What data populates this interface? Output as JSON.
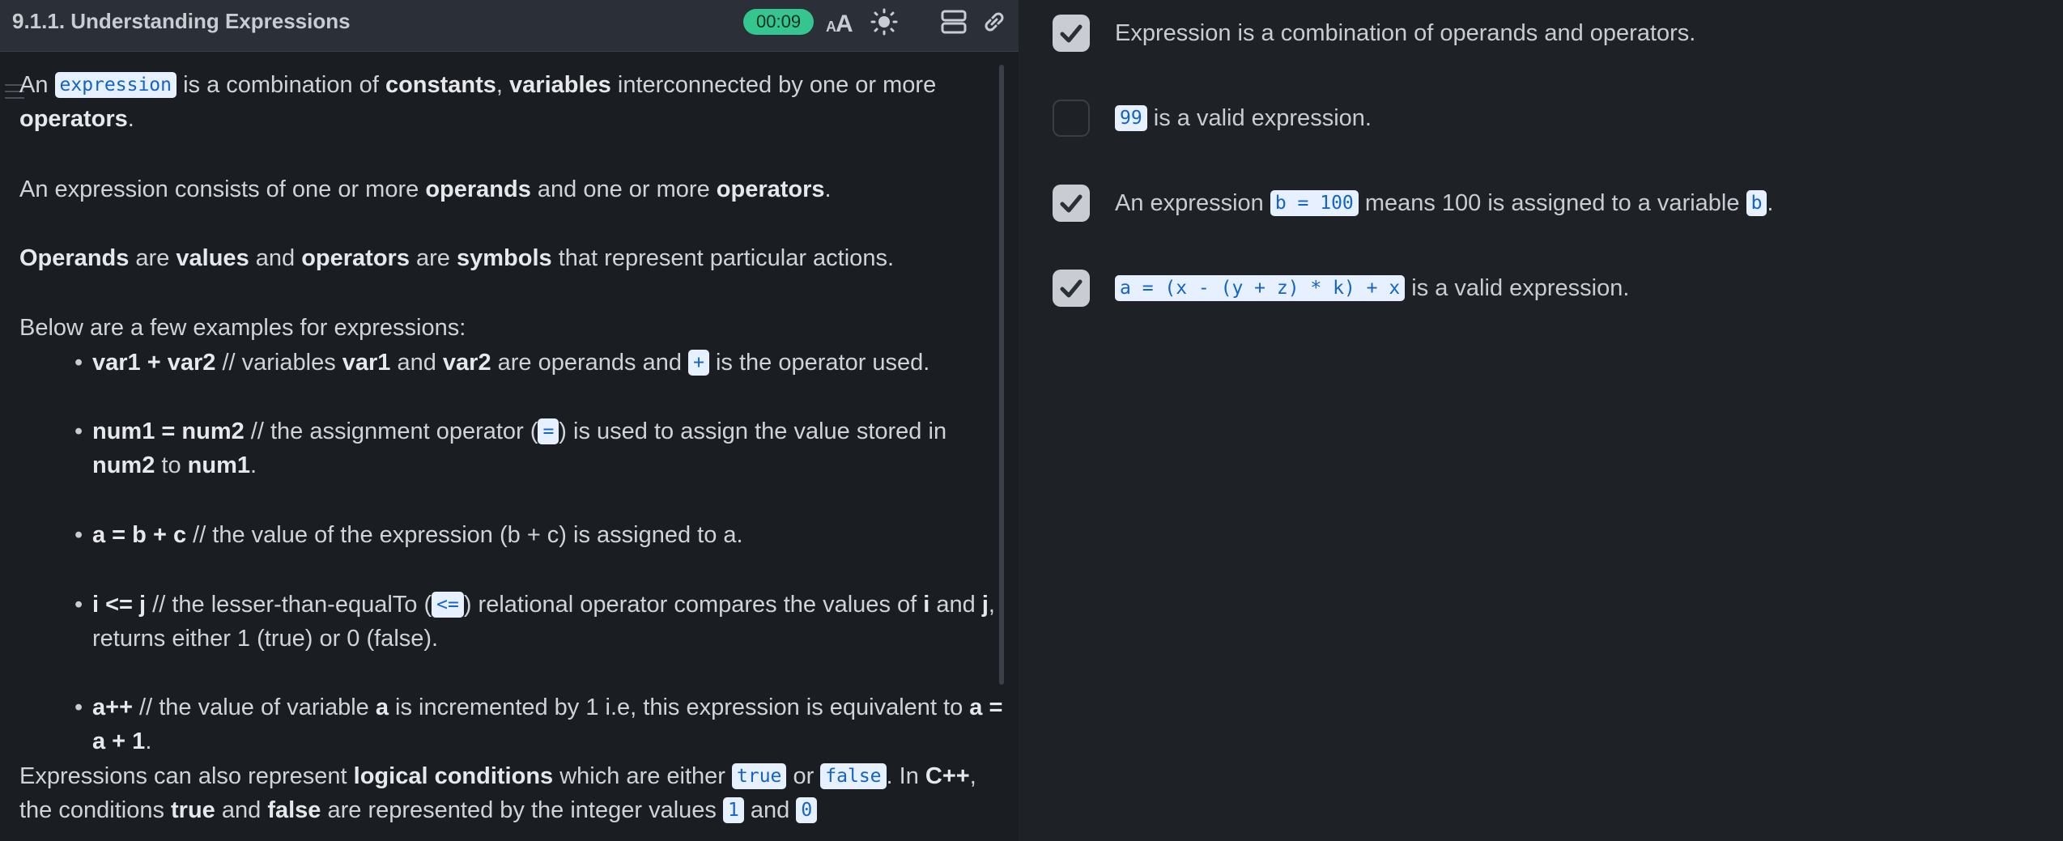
{
  "header": {
    "title": "9.1.1. Understanding Expressions",
    "timer": "00:09"
  },
  "lesson": {
    "p1": {
      "a": "An ",
      "code": "expression",
      "b": " is a combination of ",
      "c": "constants",
      "d": ", ",
      "e": "variables",
      "f": " interconnected by one or more ",
      "g": "operators",
      "h": "."
    },
    "p2": {
      "a": "An expression consists of one or more ",
      "b": "operands",
      "c": " and one or more ",
      "d": "operators",
      "e": "."
    },
    "p3": {
      "a": "Operands",
      "b": " are ",
      "c": "values",
      "d": " and ",
      "e": "operators",
      "f": " are ",
      "g": "symbols",
      "h": " that represent particular actions."
    },
    "p4": "Below are a few examples for expressions:",
    "bullet1": {
      "a": "var1 + var2",
      "b": " // variables ",
      "c": "var1",
      "d": " and ",
      "e": "var2",
      "f": " are operands and ",
      "code": "+",
      "g": " is the operator used."
    },
    "bullet2": {
      "a": "num1 = num2",
      "b": " // the assignment operator (",
      "code": "=",
      "c": ") is used to assign the value stored in ",
      "d": "num2",
      "e": " to ",
      "f": "num1",
      "g": "."
    },
    "bullet3": {
      "a": "a = b + c",
      "b": " // the value of the expression (b + c) is assigned to a."
    },
    "bullet4": {
      "a": "i <= j",
      "b": " // the lesser-than-equalTo (",
      "code": "<=",
      "c": ") relational operator compares the values of ",
      "d": "i",
      "e": " and ",
      "f": "j",
      "g": ", returns either 1 (true) or 0 (false)."
    },
    "bullet5": {
      "a": "a++",
      "b": " // the value of variable ",
      "c": "a",
      "d": " is incremented by 1 i.e, this expression is equivalent to ",
      "e": "a = a + 1",
      "f": "."
    },
    "p5": {
      "a": "Expressions can also represent ",
      "b": "logical conditions",
      "c": " which are either ",
      "code1": "true",
      "d": " or ",
      "code2": "false",
      "e": ". In ",
      "f": "C++",
      "g": ", the conditions ",
      "h": "true",
      "i": " and ",
      "j": "false",
      "k": " are represented by the integer values ",
      "code3": "1",
      "l": " and ",
      "code4": "0"
    },
    "bullet_char": "•"
  },
  "options": [
    {
      "checked": true,
      "text": "Expression is a combination of operands and operators."
    },
    {
      "checked": false,
      "code": "99",
      "text": " is a valid expression."
    },
    {
      "checked": true,
      "pre": "An expression ",
      "code": "b = 100",
      "mid": " means 100 is assigned to a variable ",
      "code2": "b",
      "post": "."
    },
    {
      "checked": true,
      "code": "a = (x - (y + z) * k) + x",
      "text": " is a valid expression."
    }
  ],
  "colors": {
    "accent": "#35c58f",
    "code_bg": "#e6f0ff",
    "code_fg": "#1463c8"
  }
}
